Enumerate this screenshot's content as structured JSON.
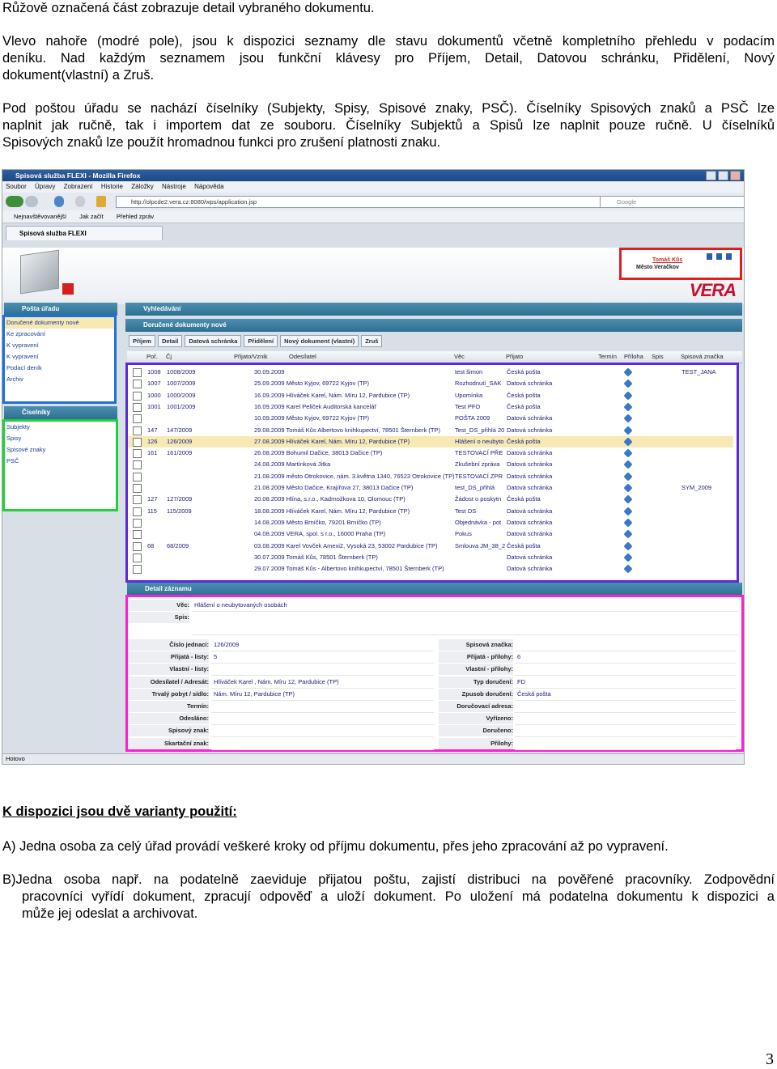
{
  "intro": {
    "p1": "Růžově označená část zobrazuje detail vybraného dokumentu.",
    "p2": [
      "Vlevo nahoře (modré pole), jsou k dispozici seznamy dle stavu dokumentů včetně kompletního přehledu v podacím",
      "deníku. Nad každým seznamem jsou funkční klávesy pro Příjem, Detail, Datovou schránku, Přidělení, Nový",
      "dokument(vlastní) a Zruš."
    ],
    "p3": [
      "Pod poštou úřadu se nachází číselníky (Subjekty, Spisy, Spisové znaky, PSČ). Číselníky Spisových znaků a PSČ lze",
      "naplnit jak ručně, tak i importem dat ze souboru. Číselníky Subjektů a Spisů lze naplnit pouze ručně. U číselníků",
      "Spisových znaků lze použít hromadnou funkci pro zrušení platnosti znaku."
    ]
  },
  "screenshot": {
    "window_title": "Spisová služba FLEXI - Mozilla Firefox",
    "menu": [
      "Soubor",
      "Úpravy",
      "Zobrazení",
      "Historie",
      "Záložky",
      "Nástroje",
      "Nápověda"
    ],
    "url": "http://olpcde2.vera.cz:8080/wps/application.jsp",
    "search_placeholder": "Google",
    "bookmarks": [
      "Nejnavštěvovanější",
      "Jak začít",
      "Přehled zpráv"
    ],
    "tab": "Spisová služba FLEXI",
    "user": {
      "name": "Tomáš Kůs",
      "org": "Město Veračkov"
    },
    "logo": "VERA",
    "left_panel": {
      "title": "Pošta úřadu",
      "items": [
        "Doručené dokumenty nové",
        "Ke zpracování",
        "K vypravení",
        "K vypravení",
        "Podací deník",
        "Archiv"
      ],
      "ciselniky_title": "Číselníky",
      "ciselniky": [
        "Subjekty",
        "Spisy",
        "Spisové znaky",
        "PSČ"
      ]
    },
    "search_header": "Vyhledávání",
    "list_header": "Doručené dokumenty nové",
    "toolbar": [
      "Příjem",
      "Detail",
      "Datová schránka",
      "Přidělení",
      "Nový dokument (vlastní)",
      "Zruš"
    ],
    "columns": [
      "Poř.",
      "Čj",
      "Přijato/Vznik",
      "Odesílatel",
      "Věc",
      "Přijato",
      "Termín",
      "Příloha",
      "Spis",
      "Spisová značka"
    ],
    "rows": [
      {
        "por": "1008",
        "cj": "1008/2009",
        "date": "30.09.2009",
        "sender": "",
        "vec": "test šimon",
        "prijato": "Česká pošta",
        "spis": "",
        "znacka": "TEST_JANA"
      },
      {
        "por": "1007",
        "cj": "1007/2009",
        "date": "25.09.2009 Město Kyjov, 69722 Kyjov (TP)",
        "sender": "",
        "vec": "Rozhodnutí_SAK",
        "prijato": "Datová schránka",
        "spis": "",
        "znacka": ""
      },
      {
        "por": "1000",
        "cj": "1000/2009",
        "date": "16.09.2009 Hlíváček Karel, Nám. Míru 12, Pardubice (TP)",
        "sender": "",
        "vec": "Upomínka",
        "prijato": "Česká pošta",
        "spis": "",
        "znacka": ""
      },
      {
        "por": "1001",
        "cj": "1001/2009",
        "date": "16.09.2009 Karel Peliček Auditorská kancelář",
        "sender": "",
        "vec": "Test PFO",
        "prijato": "Česká pošta",
        "spis": "",
        "znacka": ""
      },
      {
        "por": "",
        "cj": "",
        "date": "10.09.2009 Město Kyjov, 69722 Kyjov (TP)",
        "sender": "",
        "vec": "POŠTA 2009",
        "prijato": "Datová schránka",
        "spis": "",
        "znacka": ""
      },
      {
        "por": "147",
        "cj": "147/2009",
        "date": "29.08.2009 Tomáš Kůs Albertovo knihkupectví, 78501 Šternberk (TP)",
        "sender": "",
        "vec": "Test_DS_přihlá 20",
        "prijato": "Datová schránka",
        "spis": "",
        "znacka": ""
      },
      {
        "por": "126",
        "cj": "126/2009",
        "date": "27.08.2009 Hlíváček Karel, Nám. Míru 12, Pardubice (TP)",
        "sender": "",
        "vec": "Hlášení o neubyto 20",
        "prijato": "Česká pošta",
        "spis": "",
        "znacka": ""
      },
      {
        "por": "161",
        "cj": "161/2009",
        "date": "26.08.2009 Bohumil Dačice, 38013 Dačice (TP)",
        "sender": "",
        "vec": "TESTOVACÍ PŘE",
        "prijato": "Datová schránka",
        "spis": "",
        "znacka": ""
      },
      {
        "por": "",
        "cj": "",
        "date": "24.08.2009 Martínková Jitka",
        "sender": "",
        "vec": "Zkušební zpráva",
        "prijato": "Datová schránka",
        "spis": "",
        "znacka": ""
      },
      {
        "por": "",
        "cj": "",
        "date": "21.08.2009 město Otrokovice, nám. 3.května 1340, 76523 Otrokovice (TP)",
        "sender": "",
        "vec": "TESTOVACÍ ZPR",
        "prijato": "Datová schránka",
        "spis": "",
        "znacka": ""
      },
      {
        "por": "",
        "cj": "",
        "date": "21.08.2009 Město Dačice, Krajířova 27, 38013 Dačice (TP)",
        "sender": "",
        "vec": "test_DS_přihlá",
        "prijato": "Datová schránka",
        "spis": "",
        "znacka": "SYM_2009"
      },
      {
        "por": "127",
        "cj": "127/2009",
        "date": "20.08.2009 Hlína, s.r.o., Kadrnožkova 10, Olomouc (TP)",
        "sender": "",
        "vec": "Žádost o poskytn",
        "prijato": "Česká pošta",
        "spis": "",
        "znacka": ""
      },
      {
        "por": "115",
        "cj": "115/2009",
        "date": "18.08.2009 Hlíváček Karel, Nám. Míru 12, Pardubice (TP)",
        "sender": "",
        "vec": "Test DS",
        "prijato": "Datová schránka",
        "spis": "",
        "znacka": ""
      },
      {
        "por": "",
        "cj": "",
        "date": "14.08.2009 Město Brníčko, 79201 Brníčko (TP)",
        "sender": "",
        "vec": "Objednávka - pot",
        "prijato": "Datová schránka",
        "spis": "",
        "znacka": ""
      },
      {
        "por": "",
        "cj": "",
        "date": "04.08.2009 VERA, spol. s r.o., 16000 Praha (TP)",
        "sender": "",
        "vec": "Pokus",
        "prijato": "Datová schránka",
        "spis": "",
        "znacka": ""
      },
      {
        "por": "68",
        "cj": "68/2009",
        "date": "03.08.2009 Karel Vovček Amexi2, Vysoká 23, 53002 Pardubice (TP)",
        "sender": "",
        "vec": "Smlouva JM_38_2",
        "prijato": "Česká pošta",
        "spis": "",
        "znacka": ""
      },
      {
        "por": "",
        "cj": "",
        "date": "30.07.2009 Tomáš Kůs, 78501 Šternberk (TP)",
        "sender": "",
        "vec": "",
        "prijato": "Datová schránka",
        "spis": "",
        "znacka": ""
      },
      {
        "por": "",
        "cj": "",
        "date": "29.07.2009 Tomáš Kůs - Albertovo knihkupectví, 78501 Šternberk (TP)",
        "sender": "",
        "vec": "",
        "prijato": "Datová schránka",
        "spis": "",
        "znacka": ""
      }
    ],
    "detail": {
      "title": "Detail záznamu",
      "vec_label": "Věc:",
      "vec_value": "Hlášení o neubytovaných osobách",
      "spis_label": "Spis:",
      "left": [
        {
          "label": "Číslo jednací:",
          "value": "126/2009"
        },
        {
          "label": "Přijatá - listy:",
          "value": "5"
        },
        {
          "label": "Vlastní - listy:",
          "value": ""
        },
        {
          "label": "Odesílatel / Adresát:",
          "value": "Hlíváček Karel , Nám. Míru 12, Pardubice (TP)"
        },
        {
          "label": "Trvalý pobyt / sídlo:",
          "value": "Nám. Míru 12, Pardubice (TP)"
        },
        {
          "label": "Termín:",
          "value": ""
        },
        {
          "label": "Odesláno:",
          "value": ""
        },
        {
          "label": "Spisový znak:",
          "value": ""
        },
        {
          "label": "Skartační znak:",
          "value": ""
        }
      ],
      "right": [
        {
          "label": "Spisová značka:",
          "value": ""
        },
        {
          "label": "Přijatá - přílohy:",
          "value": "6"
        },
        {
          "label": "Vlastní - přílohy:",
          "value": ""
        },
        {
          "label": "Typ doručení:",
          "value": "FD"
        },
        {
          "label": "Zpusob doručení:",
          "value": "Česká pošta"
        },
        {
          "label": "Doručovací adresa:",
          "value": ""
        },
        {
          "label": "Vyřízeno:",
          "value": ""
        },
        {
          "label": "Doručeno:",
          "value": ""
        },
        {
          "label": "Přílohy:",
          "value": ""
        }
      ]
    },
    "status": "Hotovo"
  },
  "usage": {
    "heading": "K dispozici jsou dvě varianty použití:",
    "a": "A) Jedna osoba za celý úřad provádí veškeré kroky od příjmu dokumentu, přes jeho zpracování až po vypravení.",
    "b1": "B)Jedna osoba např. na podatelně zaeviduje přijatou poštu, zajistí distribuci na pověřené pracovníky. Zodpovědní",
    "b2": "pracovníci vyřídí dokument, zpracují odpověď a uloží dokument. Po uložení má podatelna dokumentu k dispozici a",
    "b3": "může jej odeslat a archivovat."
  },
  "page_number": "3"
}
